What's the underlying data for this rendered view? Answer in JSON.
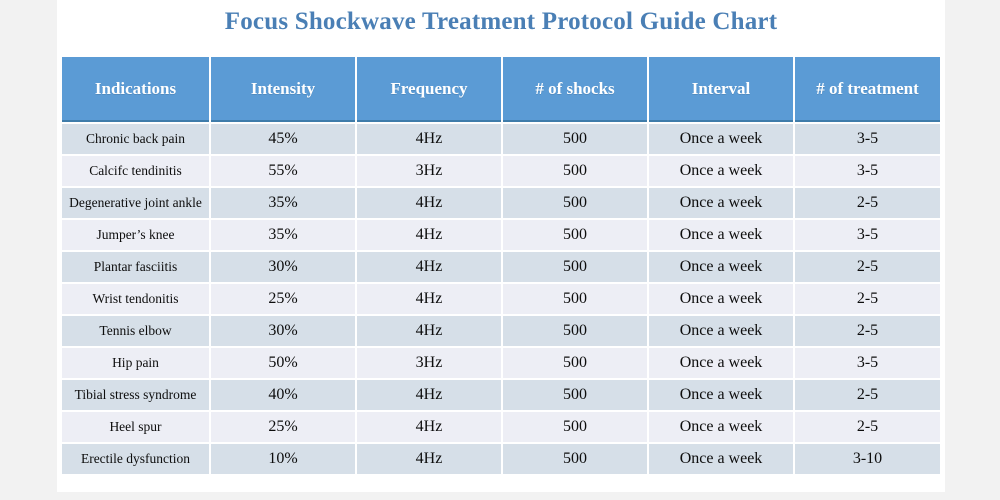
{
  "document": {
    "title": "Focus Shockwave Treatment Protocol Guide Chart",
    "accent_color": "#5b9bd5",
    "title_color": "#4a7fb5",
    "row_color_odd": "#d6dfe8",
    "row_color_even": "#edeef5",
    "page_background": "#ffffff",
    "canvas_background": "#f2f2f2"
  },
  "table": {
    "columns": [
      "Indications",
      "Intensity",
      "Frequency",
      "# of shocks",
      "Interval",
      "# of treatment"
    ],
    "rows": [
      {
        "indication": "Chronic back pain",
        "intensity": "45%",
        "frequency": "4Hz",
        "shocks": "500",
        "interval": "Once a week",
        "treatments": "3-5"
      },
      {
        "indication": "Calcifc tendinitis",
        "intensity": "55%",
        "frequency": "3Hz",
        "shocks": "500",
        "interval": "Once a week",
        "treatments": "3-5"
      },
      {
        "indication": "Degenerative joint ankle",
        "intensity": "35%",
        "frequency": "4Hz",
        "shocks": "500",
        "interval": "Once a week",
        "treatments": "2-5"
      },
      {
        "indication": "Jumper’s knee",
        "intensity": "35%",
        "frequency": "4Hz",
        "shocks": "500",
        "interval": "Once a week",
        "treatments": "3-5"
      },
      {
        "indication": "Plantar fasciitis",
        "intensity": "30%",
        "frequency": "4Hz",
        "shocks": "500",
        "interval": "Once a week",
        "treatments": "2-5"
      },
      {
        "indication": "Wrist tendonitis",
        "intensity": "25%",
        "frequency": "4Hz",
        "shocks": "500",
        "interval": "Once a week",
        "treatments": "2-5"
      },
      {
        "indication": "Tennis elbow",
        "intensity": "30%",
        "frequency": "4Hz",
        "shocks": "500",
        "interval": "Once a week",
        "treatments": "2-5"
      },
      {
        "indication": "Hip pain",
        "intensity": "50%",
        "frequency": "3Hz",
        "shocks": "500",
        "interval": "Once a week",
        "treatments": "3-5"
      },
      {
        "indication": "Tibial stress syndrome",
        "intensity": "40%",
        "frequency": "4Hz",
        "shocks": "500",
        "interval": "Once a week",
        "treatments": "2-5"
      },
      {
        "indication": "Heel spur",
        "intensity": "25%",
        "frequency": "4Hz",
        "shocks": "500",
        "interval": "Once a week",
        "treatments": "2-5"
      },
      {
        "indication": "Erectile dysfunction",
        "intensity": "10%",
        "frequency": "4Hz",
        "shocks": "500",
        "interval": "Once a week",
        "treatments": "3-10"
      }
    ]
  },
  "chart_data": {
    "type": "table",
    "title": "Focus Shockwave Treatment Protocol Guide Chart",
    "columns": [
      "Indications",
      "Intensity",
      "Frequency",
      "# of shocks",
      "Interval",
      "# of treatment"
    ],
    "rows": [
      [
        "Chronic back pain",
        "45%",
        "4Hz",
        "500",
        "Once a week",
        "3-5"
      ],
      [
        "Calcifc tendinitis",
        "55%",
        "3Hz",
        "500",
        "Once a week",
        "3-5"
      ],
      [
        "Degenerative joint ankle",
        "35%",
        "4Hz",
        "500",
        "Once a week",
        "2-5"
      ],
      [
        "Jumper’s knee",
        "35%",
        "4Hz",
        "500",
        "Once a week",
        "3-5"
      ],
      [
        "Plantar fasciitis",
        "30%",
        "4Hz",
        "500",
        "Once a week",
        "2-5"
      ],
      [
        "Wrist tendonitis",
        "25%",
        "4Hz",
        "500",
        "Once a week",
        "2-5"
      ],
      [
        "Tennis elbow",
        "30%",
        "4Hz",
        "500",
        "Once a week",
        "2-5"
      ],
      [
        "Hip pain",
        "50%",
        "3Hz",
        "500",
        "Once a week",
        "3-5"
      ],
      [
        "Tibial stress syndrome",
        "40%",
        "4Hz",
        "500",
        "Once a week",
        "2-5"
      ],
      [
        "Heel spur",
        "25%",
        "4Hz",
        "500",
        "Once a week",
        "2-5"
      ],
      [
        "Erectile dysfunction",
        "10%",
        "4Hz",
        "500",
        "Once a week",
        "3-10"
      ]
    ]
  }
}
